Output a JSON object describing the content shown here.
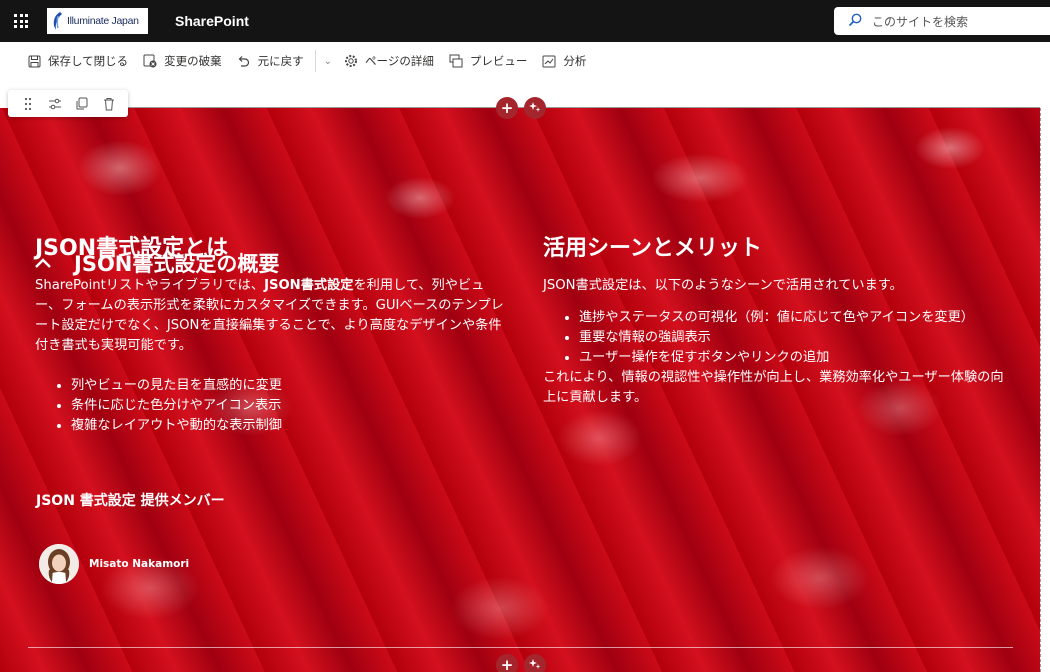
{
  "suitebar": {
    "logo_text": "Illuminate Japan",
    "app_name": "SharePoint",
    "search_placeholder": "このサイトを検索"
  },
  "commandbar": {
    "save_close": "保存して閉じる",
    "discard": "変更の破棄",
    "undo": "元に戻す",
    "page_details": "ページの詳細",
    "preview": "プレビュー",
    "analytics": "分析"
  },
  "section_toolbar": {
    "icons": [
      "drag-icon",
      "settings-icon",
      "duplicate-icon",
      "delete-icon"
    ]
  },
  "hero": {
    "title": "JSON書式設定の概要",
    "left": {
      "heading": "JSON書式設定とは",
      "para_pre": "SharePointリストやライブラリでは、",
      "para_bold": "JSON書式設定",
      "para_post": "を利用して、列やビュー、フォームの表示形式を柔軟にカスタマイズできます。GUIベースのテンプレート設定だけでなく、JSONを直接編集することで、より高度なデザインや条件付き書式も実現可能です。",
      "bullets": [
        "列やビューの見た目を直感的に変更",
        "条件に応じた色分けやアイコン表示",
        "複雑なレイアウトや動的な表示制御"
      ]
    },
    "right": {
      "heading": "活用シーンとメリット",
      "intro": "JSON書式設定は、以下のようなシーンで活用されています。",
      "bullets": [
        "進捗やステータスの可視化（例：値に応じて色やアイコンを変更）",
        "重要な情報の強調表示",
        "ユーザー操作を促すボタンやリンクの追加"
      ],
      "outro": "これにより、情報の視認性や操作性が向上し、業務効率化やユーザー体験の向上に貢献します。"
    },
    "members_title": "JSON 書式設定 提供メンバー",
    "member_name": "Misato Nakamori"
  },
  "colors": {
    "suitebar_bg": "#141414",
    "accent": "#a4262c",
    "hero_red": "#c00012"
  }
}
